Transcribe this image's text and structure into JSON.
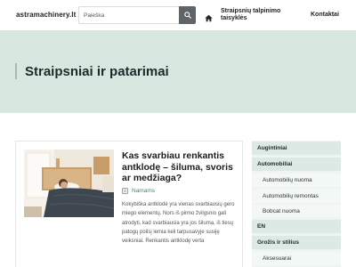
{
  "header": {
    "logo": "astramachinery.lt",
    "search_placeholder": "Paieška",
    "nav": {
      "rules": "Straipsnių talpinimo taisyklės",
      "contact": "Kontaktai"
    }
  },
  "banner": {
    "title": "Straipsniai ir patarimai"
  },
  "article": {
    "title": "Kas svarbiau renkantis antklodę – šiluma, svoris ar medžiaga?",
    "category": "Namams",
    "excerpt": "Kokybiška antklodė yra vienas svarbiausių gero miego elementų. Nors iš pirmo žvilgsnio gali atrodyti, kad svarbiausia yra jos šiluma, iš tiesų patogų poilsį lemia keli tarpusavyje susiję veiksniai. Renkantis antklodę verta"
  },
  "sidebar": {
    "items": [
      {
        "label": "Augintiniai",
        "level": "top"
      },
      {
        "label": "Automobiliai",
        "level": "top"
      },
      {
        "label": "Automobilių nuoma",
        "level": "sub"
      },
      {
        "label": "Automobilių remontas",
        "level": "sub"
      },
      {
        "label": "Bobcat nuoma",
        "level": "sub"
      },
      {
        "label": "EN",
        "level": "top"
      },
      {
        "label": "Grožis ir stilius",
        "level": "top"
      },
      {
        "label": "Aksesuarai",
        "level": "sub"
      }
    ]
  },
  "colors": {
    "banner_bg": "#d8e8e1",
    "accent": "#4a7f78",
    "search_button": "#5e6468",
    "sidebar_bg": "#eef4f1"
  },
  "icons": {
    "search": "search-icon",
    "home": "home-icon",
    "category": "folder-icon"
  }
}
